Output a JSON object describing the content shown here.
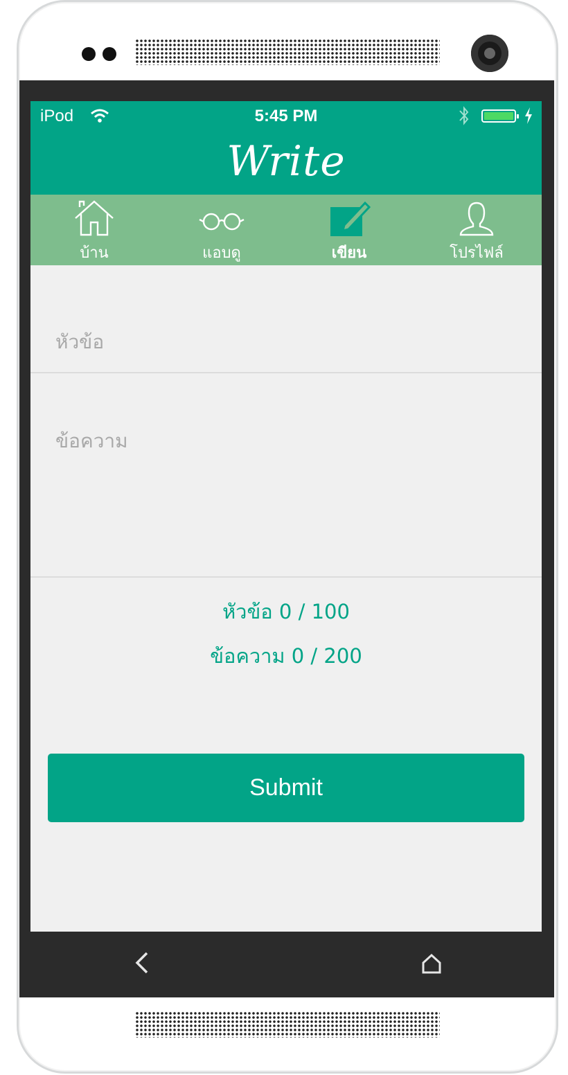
{
  "status_bar": {
    "carrier": "iPod",
    "time": "5:45 PM"
  },
  "header": {
    "title": "Write"
  },
  "tabs": [
    {
      "label": "บ้าน",
      "icon": "home-icon"
    },
    {
      "label": "แอบดู",
      "icon": "glasses-icon"
    },
    {
      "label": "เขียน",
      "icon": "compose-icon"
    },
    {
      "label": "โปรไฟล์",
      "icon": "profile-icon"
    }
  ],
  "form": {
    "title_placeholder": "หัวข้อ",
    "body_placeholder": "ข้อความ",
    "title_counter": "หัวข้อ 0 / 100",
    "body_counter": "ข้อความ 0 / 200",
    "submit_label": "Submit"
  },
  "colors": {
    "accent": "#02a487",
    "tabbar": "#7ebd8d",
    "background": "#f0f0f0"
  }
}
